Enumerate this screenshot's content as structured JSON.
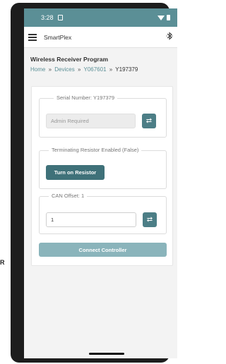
{
  "statusbar": {
    "time": "3:28"
  },
  "appbar": {
    "title": "SmartPlex",
    "bluetooth_icon": "bluetooth-icon"
  },
  "page": {
    "title": "Wireless Receiver Program",
    "breadcrumb": {
      "home": "Home",
      "sep": "»",
      "devices": "Devices",
      "parent": "Y067601",
      "current": "Y197379"
    }
  },
  "serial": {
    "legend": "Serial Number: Y197379",
    "placeholder": "Admin Required"
  },
  "resistor": {
    "legend": "Terminating Resistor Enabled (False)",
    "button": "Turn on Resistor"
  },
  "can": {
    "legend": "CAN Offset: 1",
    "value": "1"
  },
  "connect_button": "Connect Controller",
  "edge_letter": "R",
  "colors": {
    "accent": "#5b8f96",
    "button": "#3f7179",
    "disabled_button": "#8ab4bb"
  }
}
